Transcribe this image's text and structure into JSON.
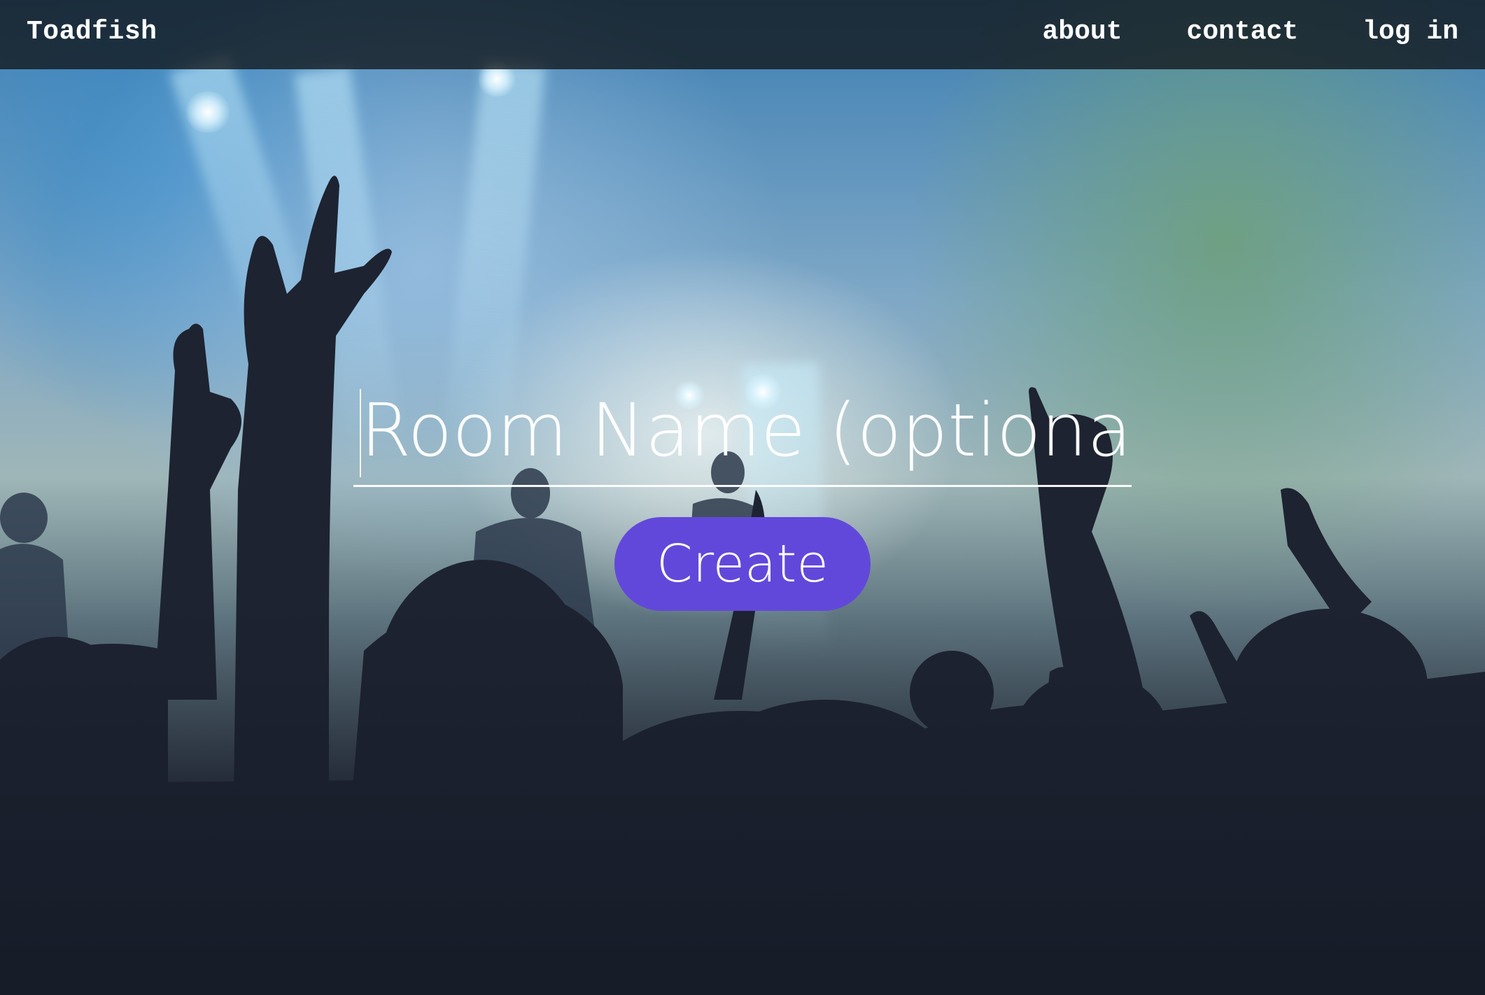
{
  "navbar": {
    "brand": "Toadfish",
    "links": [
      {
        "label": "about"
      },
      {
        "label": "contact"
      },
      {
        "label": "log in"
      }
    ]
  },
  "room_form": {
    "input_placeholder": "Room Name (optional)",
    "input_value": "",
    "create_label": "Create"
  },
  "colors": {
    "accent": "#6248da",
    "navbar_bg": "#12161a",
    "text": "#ffffff"
  }
}
